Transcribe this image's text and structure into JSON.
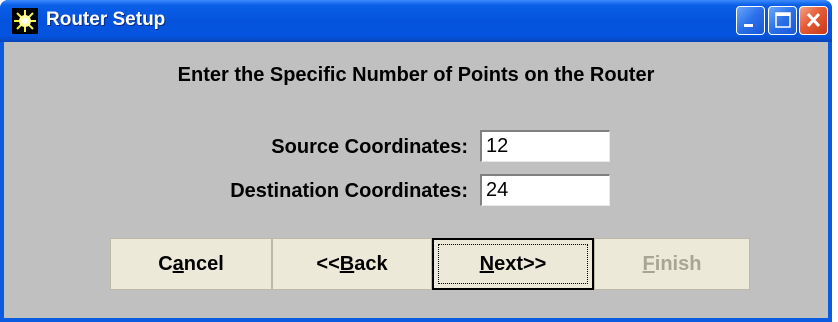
{
  "window": {
    "title": "Router Setup",
    "icon": "sun-burst-icon",
    "controls": {
      "minimize": "minimize-icon",
      "maximize": "maximize-icon",
      "close": "close-icon"
    }
  },
  "form": {
    "heading": "Enter the Specific Number of Points on the Router",
    "source_label": "Source Coordinates:",
    "source_value": "12",
    "destination_label": "Destination Coordinates:",
    "destination_value": "24"
  },
  "buttons": {
    "cancel": {
      "label": "Cancel",
      "mnemonic_index": 1
    },
    "back": {
      "label": "<<Back",
      "mnemonic_index": 2
    },
    "next": {
      "label": "Next>>",
      "mnemonic_index": 0
    },
    "finish": {
      "label": "Finish",
      "mnemonic_index": 0,
      "enabled": false
    }
  },
  "colors": {
    "titlebar": "#0553dc",
    "client_background": "#c0c0c0",
    "button_face": "#ece9d8",
    "disabled_text": "#a8a595",
    "close_button": "#e55b34"
  }
}
